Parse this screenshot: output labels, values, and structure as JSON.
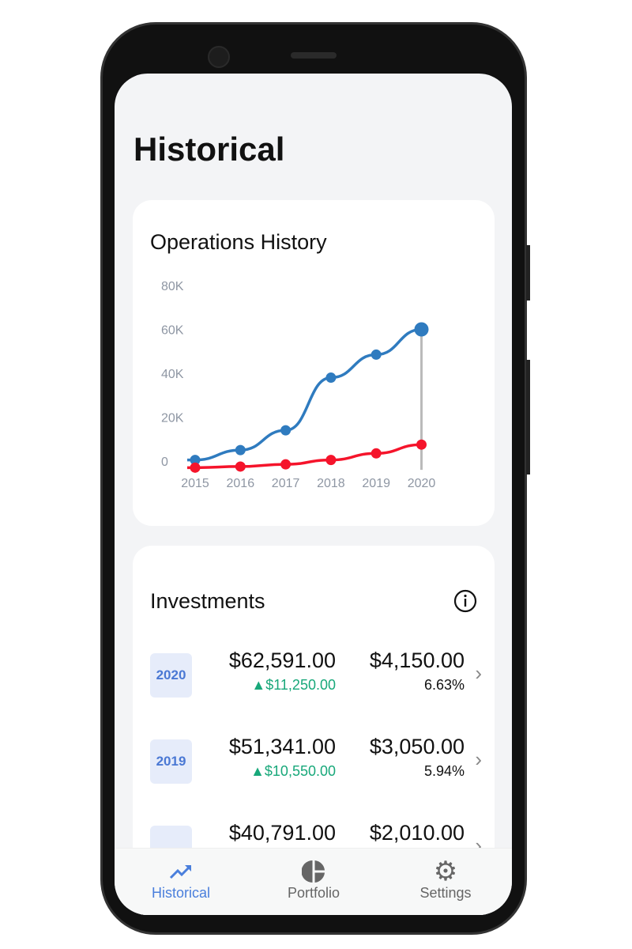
{
  "page": {
    "title": "Historical"
  },
  "history": {
    "title": "Operations History"
  },
  "chart_data": {
    "type": "line",
    "categories": [
      "2015",
      "2016",
      "2017",
      "2018",
      "2019",
      "2020"
    ],
    "y_ticks": [
      "0",
      "20K",
      "40K",
      "60K",
      "80K"
    ],
    "ylim": [
      0,
      80000
    ],
    "series": [
      {
        "color": "#2f7bbf",
        "values": [
          500,
          5000,
          14000,
          38000,
          48500,
          60000
        ]
      },
      {
        "color": "#f5142b",
        "values": [
          -3000,
          -2500,
          -1500,
          500,
          3500,
          7500
        ]
      }
    ],
    "highlight_category": "2020",
    "grid": false
  },
  "investments": {
    "title": "Investments",
    "info_icon": "info-icon",
    "rows": [
      {
        "year": "2020",
        "total": "$62,591.00",
        "change": "▲$11,250.00",
        "gain": "$4,150.00",
        "pct": "6.63%"
      },
      {
        "year": "2019",
        "total": "$51,341.00",
        "change": "▲$10,550.00",
        "gain": "$3,050.00",
        "pct": "5.94%"
      },
      {
        "year": "",
        "total": "$40,791.00",
        "change": "",
        "gain": "$2,010.00",
        "pct": ""
      }
    ],
    "positive_color": "#18a87a"
  },
  "nav": {
    "items": [
      {
        "label": "Historical",
        "icon": "trending-up-icon",
        "active": true
      },
      {
        "label": "Portfolio",
        "icon": "pie-chart-icon"
      },
      {
        "label": "Settings",
        "icon": "gear-icon"
      }
    ],
    "active_color": "#4a7fdc"
  }
}
